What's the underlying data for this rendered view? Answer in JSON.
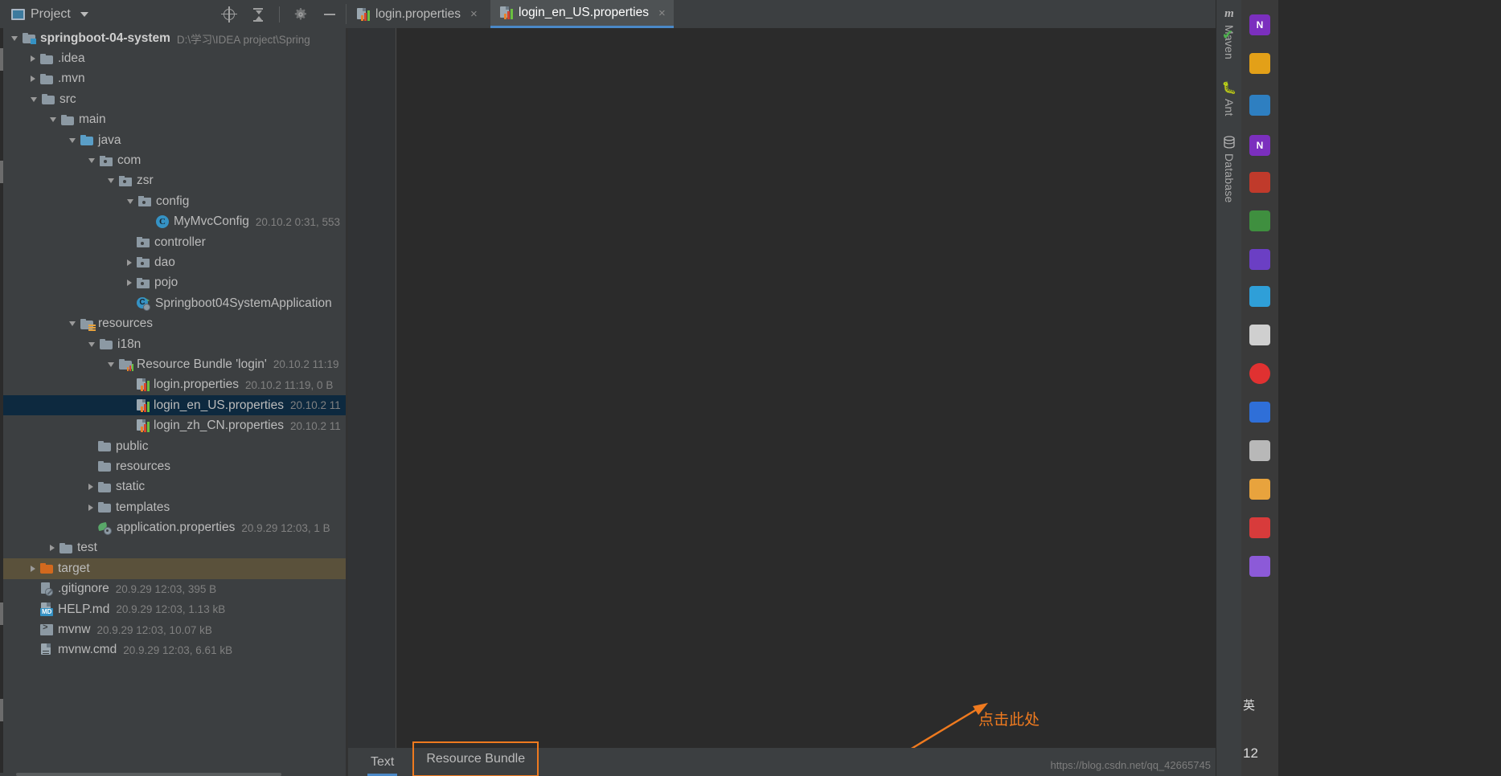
{
  "window": {
    "tool_window_title": "Project",
    "header_icons": [
      "locate-icon",
      "collapse-all-icon",
      "settings-gear-icon",
      "minimize-icon"
    ]
  },
  "tabs": [
    {
      "label": "login.properties",
      "icon": "properties-file-icon",
      "active": false,
      "close": "×"
    },
    {
      "label": "login_en_US.properties",
      "icon": "properties-file-icon",
      "active": true,
      "close": "×"
    }
  ],
  "tree": [
    {
      "label": "springboot-04-system",
      "meta": "D:\\学习\\IDEA project\\Spring",
      "indent": 0,
      "arrow": "open",
      "icon": "module-folder-icon",
      "bold": true,
      "state": "normal"
    },
    {
      "label": ".idea",
      "meta": "",
      "indent": 1,
      "arrow": "closed",
      "icon": "folder-icon",
      "bold": false,
      "state": "normal"
    },
    {
      "label": ".mvn",
      "meta": "",
      "indent": 1,
      "arrow": "closed",
      "icon": "folder-icon",
      "bold": false,
      "state": "normal"
    },
    {
      "label": "src",
      "meta": "",
      "indent": 1,
      "arrow": "open",
      "icon": "folder-icon",
      "bold": false,
      "state": "normal"
    },
    {
      "label": "main",
      "meta": "",
      "indent": 2,
      "arrow": "open",
      "icon": "folder-icon",
      "bold": false,
      "state": "normal"
    },
    {
      "label": "java",
      "meta": "",
      "indent": 3,
      "arrow": "open",
      "icon": "source-folder-icon",
      "bold": false,
      "state": "normal"
    },
    {
      "label": "com",
      "meta": "",
      "indent": 4,
      "arrow": "open",
      "icon": "package-icon",
      "bold": false,
      "state": "normal"
    },
    {
      "label": "zsr",
      "meta": "",
      "indent": 5,
      "arrow": "open",
      "icon": "package-icon",
      "bold": false,
      "state": "normal"
    },
    {
      "label": "config",
      "meta": "",
      "indent": 6,
      "arrow": "open",
      "icon": "package-icon",
      "bold": false,
      "state": "normal"
    },
    {
      "label": "MyMvcConfig",
      "meta": "20.10.2 0:31, 553",
      "indent": 7,
      "arrow": "none",
      "icon": "java-class-icon",
      "bold": false,
      "state": "normal"
    },
    {
      "label": "controller",
      "meta": "",
      "indent": 6,
      "arrow": "none",
      "icon": "package-icon",
      "bold": false,
      "state": "normal"
    },
    {
      "label": "dao",
      "meta": "",
      "indent": 6,
      "arrow": "closed",
      "icon": "package-icon",
      "bold": false,
      "state": "normal"
    },
    {
      "label": "pojo",
      "meta": "",
      "indent": 6,
      "arrow": "closed",
      "icon": "package-icon",
      "bold": false,
      "state": "normal"
    },
    {
      "label": "Springboot04SystemApplication",
      "meta": "",
      "indent": 6,
      "arrow": "none",
      "icon": "springboot-app-icon",
      "bold": false,
      "state": "normal"
    },
    {
      "label": "resources",
      "meta": "",
      "indent": 3,
      "arrow": "open",
      "icon": "resource-folder-icon",
      "bold": false,
      "state": "normal"
    },
    {
      "label": "i18n",
      "meta": "",
      "indent": 4,
      "arrow": "open",
      "icon": "folder-icon",
      "bold": false,
      "state": "normal"
    },
    {
      "label": "Resource Bundle 'login'",
      "meta": "20.10.2 11:19",
      "indent": 5,
      "arrow": "open",
      "icon": "resource-bundle-icon",
      "bold": false,
      "state": "normal"
    },
    {
      "label": "login.properties",
      "meta": "20.10.2 11:19, 0 B",
      "indent": 6,
      "arrow": "none",
      "icon": "properties-file-icon",
      "bold": false,
      "state": "normal"
    },
    {
      "label": "login_en_US.properties",
      "meta": "20.10.2 11",
      "indent": 6,
      "arrow": "none",
      "icon": "properties-file-icon",
      "bold": false,
      "state": "selected"
    },
    {
      "label": "login_zh_CN.properties",
      "meta": "20.10.2 11",
      "indent": 6,
      "arrow": "none",
      "icon": "properties-file-icon",
      "bold": false,
      "state": "normal"
    },
    {
      "label": "public",
      "meta": "",
      "indent": 4,
      "arrow": "none",
      "icon": "folder-icon",
      "bold": false,
      "state": "normal"
    },
    {
      "label": "resources",
      "meta": "",
      "indent": 4,
      "arrow": "none",
      "icon": "folder-icon",
      "bold": false,
      "state": "normal"
    },
    {
      "label": "static",
      "meta": "",
      "indent": 4,
      "arrow": "closed",
      "icon": "folder-icon",
      "bold": false,
      "state": "normal"
    },
    {
      "label": "templates",
      "meta": "",
      "indent": 4,
      "arrow": "closed",
      "icon": "folder-icon",
      "bold": false,
      "state": "normal"
    },
    {
      "label": "application.properties",
      "meta": "20.9.29 12:03, 1 B",
      "indent": 4,
      "arrow": "none",
      "icon": "spring-properties-icon",
      "bold": false,
      "state": "normal"
    },
    {
      "label": "test",
      "meta": "",
      "indent": 2,
      "arrow": "closed",
      "icon": "folder-icon",
      "bold": false,
      "state": "normal"
    },
    {
      "label": "target",
      "meta": "",
      "indent": 1,
      "arrow": "closed",
      "icon": "excluded-folder-icon",
      "bold": false,
      "state": "hovered"
    },
    {
      "label": ".gitignore",
      "meta": "20.9.29 12:03, 395 B",
      "indent": 1,
      "arrow": "none",
      "icon": "gitignore-file-icon",
      "bold": false,
      "state": "normal"
    },
    {
      "label": "HELP.md",
      "meta": "20.9.29 12:03, 1.13 kB",
      "indent": 1,
      "arrow": "none",
      "icon": "markdown-file-icon",
      "bold": false,
      "state": "normal"
    },
    {
      "label": "mvnw",
      "meta": "20.9.29 12:03, 10.07 kB",
      "indent": 1,
      "arrow": "none",
      "icon": "shell-script-icon",
      "bold": false,
      "state": "normal"
    },
    {
      "label": "mvnw.cmd",
      "meta": "20.9.29 12:03, 6.61 kB",
      "indent": 1,
      "arrow": "none",
      "icon": "text-file-icon",
      "bold": false,
      "state": "normal"
    }
  ],
  "editor_bottom_tabs": [
    {
      "label": "Text",
      "active": true,
      "annotated": false
    },
    {
      "label": "Resource Bundle",
      "active": false,
      "annotated": true
    }
  ],
  "annotation": {
    "text": "点击此处",
    "color": "#ef7a1f"
  },
  "right_tool_strip": [
    {
      "label": "Maven",
      "icon": "maven-m-icon"
    },
    {
      "label": "Ant",
      "icon": "ant-bug-icon"
    },
    {
      "label": "Database",
      "icon": "database-icon"
    }
  ],
  "status": {
    "inspection_check": "✔",
    "watermark": "https://blog.csdn.net/qq_42665745"
  },
  "taskbar": {
    "ime_label": "英",
    "clock": "12"
  },
  "colors": {
    "accent_blue": "#4a88c7",
    "selection": "#0d293f",
    "hover": "#5a513b",
    "panel_bg": "#3c3f41",
    "editor_bg": "#2b2b2b",
    "annotation_orange": "#ef7a1f"
  }
}
